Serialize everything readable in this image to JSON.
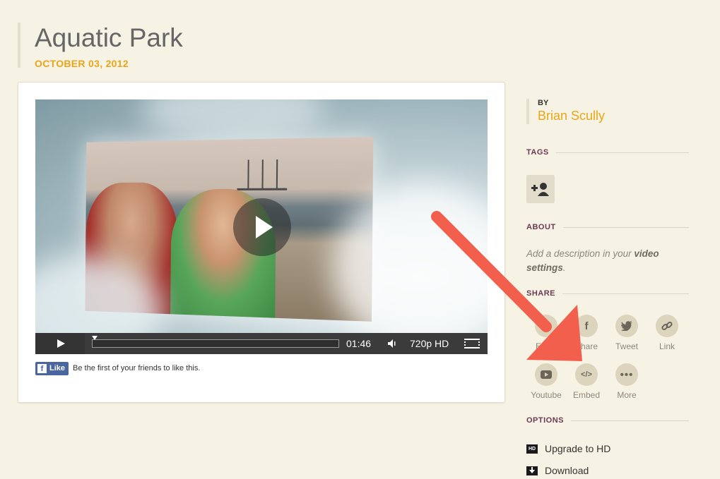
{
  "page": {
    "title": "Aquatic Park",
    "date": "OCTOBER 03, 2012"
  },
  "player": {
    "time": "01:46",
    "quality": "720p HD"
  },
  "facebook": {
    "like_label": "Like",
    "like_text": "Be the first of your friends to like this."
  },
  "sidebar": {
    "by_label": "BY",
    "author": "Brian Scully",
    "tags_heading": "TAGS",
    "about_heading": "ABOUT",
    "about_text_prefix": "Add a description in your ",
    "about_text_link": "video settings",
    "about_text_suffix": ".",
    "share_heading": "SHARE",
    "share_items": [
      {
        "label": "Email",
        "icon": "email-icon"
      },
      {
        "label": "Share",
        "icon": "facebook-icon"
      },
      {
        "label": "Tweet",
        "icon": "twitter-icon"
      },
      {
        "label": "Link",
        "icon": "link-icon"
      },
      {
        "label": "Youtube",
        "icon": "youtube-icon"
      },
      {
        "label": "Embed",
        "icon": "embed-icon"
      },
      {
        "label": "More",
        "icon": "more-icon"
      }
    ],
    "options_heading": "OPTIONS",
    "options": [
      {
        "label": "Upgrade to HD",
        "icon": "hd-icon"
      },
      {
        "label": "Download",
        "icon": "download-icon"
      }
    ]
  },
  "colors": {
    "background": "#f6f2e4",
    "accent": "#e8a61a",
    "heading": "#6b3a54",
    "arrow": "#f25f4c"
  }
}
